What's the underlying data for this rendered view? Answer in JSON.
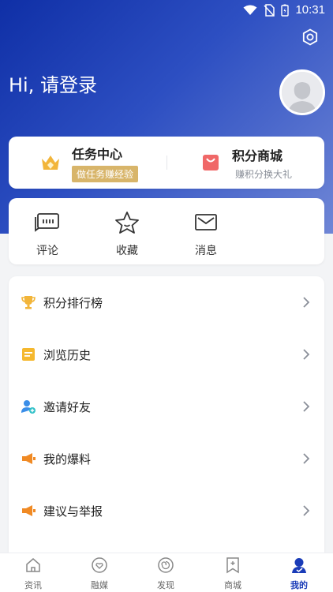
{
  "status": {
    "time": "10:31"
  },
  "header": {
    "greeting": "Hi, 请登录"
  },
  "top_cards": {
    "task": {
      "title": "任务中心",
      "subtitle": "做任务赚经验"
    },
    "shop": {
      "title": "积分商城",
      "subtitle": "赚积分换大礼"
    }
  },
  "quick": [
    {
      "label": "评论",
      "icon": "comment-icon"
    },
    {
      "label": "收藏",
      "icon": "star-icon"
    },
    {
      "label": "消息",
      "icon": "mail-icon"
    }
  ],
  "menu": [
    {
      "label": "积分排行榜",
      "icon": "trophy-icon"
    },
    {
      "label": "浏览历史",
      "icon": "history-icon"
    },
    {
      "label": "邀请好友",
      "icon": "invite-icon"
    },
    {
      "label": "我的爆料",
      "icon": "tip-icon"
    },
    {
      "label": "建议与举报",
      "icon": "report-icon"
    }
  ],
  "nav": [
    {
      "label": "资讯",
      "icon": "home-icon"
    },
    {
      "label": "融媒",
      "icon": "media-icon"
    },
    {
      "label": "发现",
      "icon": "discover-icon"
    },
    {
      "label": "商城",
      "icon": "mall-icon"
    },
    {
      "label": "我的",
      "icon": "profile-icon",
      "active": true
    }
  ],
  "colors": {
    "brand": "#1a3cb8",
    "gold": "#d8b56a",
    "orange": "#f08a24"
  }
}
